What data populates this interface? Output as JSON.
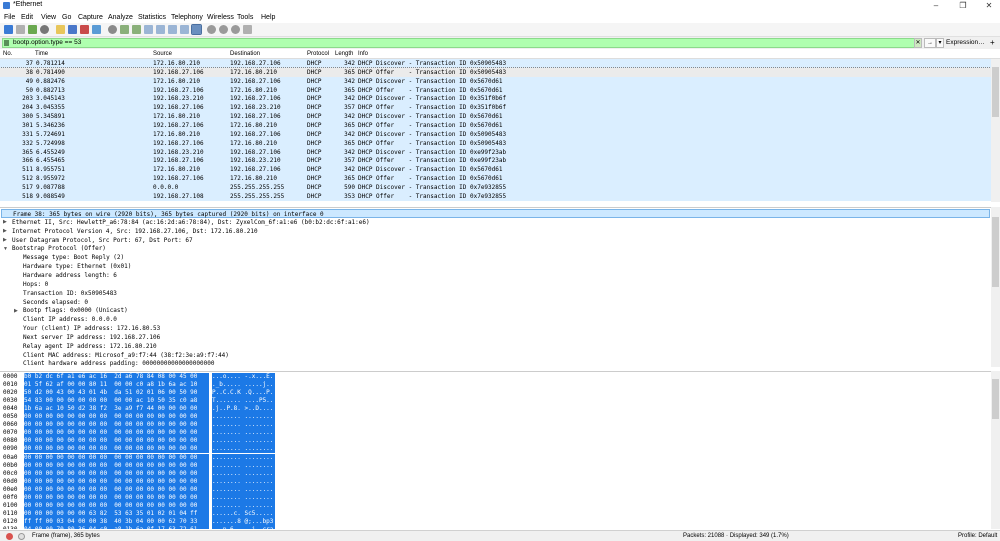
{
  "window": {
    "title": "*Ethernet"
  },
  "menu": [
    "File",
    "Edit",
    "View",
    "Go",
    "Capture",
    "Analyze",
    "Statistics",
    "Telephony",
    "Wireless",
    "Tools",
    "Help"
  ],
  "filter": {
    "value": "bootp.option.type == 53",
    "expression_label": "Expression…",
    "plus": "+"
  },
  "packet_list": {
    "columns": [
      "No.",
      "Time",
      "Source",
      "Destination",
      "Protocol",
      "Length",
      "Info"
    ],
    "rows": [
      [
        "37",
        "0.781214",
        "172.16.80.210",
        "192.168.27.106",
        "DHCP",
        "342",
        "DHCP Discover - Transaction ID 0x50905483"
      ],
      [
        "38",
        "0.781490",
        "192.168.27.106",
        "172.16.80.210",
        "DHCP",
        "365",
        "DHCP Offer    - Transaction ID 0x50905483"
      ],
      [
        "49",
        "0.882476",
        "172.16.80.210",
        "192.168.27.106",
        "DHCP",
        "342",
        "DHCP Discover - Transaction ID 0x5670d61"
      ],
      [
        "50",
        "0.882713",
        "192.168.27.106",
        "172.16.80.210",
        "DHCP",
        "365",
        "DHCP Offer    - Transaction ID 0x5670d61"
      ],
      [
        "203",
        "3.045143",
        "192.168.23.210",
        "192.168.27.106",
        "DHCP",
        "342",
        "DHCP Discover - Transaction ID 0x351f0b6f"
      ],
      [
        "204",
        "3.045355",
        "192.168.27.106",
        "192.168.23.210",
        "DHCP",
        "357",
        "DHCP Offer    - Transaction ID 0x351f0b6f"
      ],
      [
        "300",
        "5.345891",
        "172.16.80.210",
        "192.168.27.106",
        "DHCP",
        "342",
        "DHCP Discover - Transaction ID 0x5670d61"
      ],
      [
        "301",
        "5.346236",
        "192.168.27.106",
        "172.16.80.210",
        "DHCP",
        "365",
        "DHCP Offer    - Transaction ID 0x5670d61"
      ],
      [
        "331",
        "5.724691",
        "172.16.80.210",
        "192.168.27.106",
        "DHCP",
        "342",
        "DHCP Discover - Transaction ID 0x50905483"
      ],
      [
        "332",
        "5.724998",
        "192.168.27.106",
        "172.16.80.210",
        "DHCP",
        "365",
        "DHCP Offer    - Transaction ID 0x50905483"
      ],
      [
        "365",
        "6.455249",
        "192.168.23.210",
        "192.168.27.106",
        "DHCP",
        "342",
        "DHCP Discover - Transaction ID 0xe99f23ab"
      ],
      [
        "366",
        "6.455465",
        "192.168.27.106",
        "192.168.23.210",
        "DHCP",
        "357",
        "DHCP Offer    - Transaction ID 0xe99f23ab"
      ],
      [
        "511",
        "8.955751",
        "172.16.80.210",
        "192.168.27.106",
        "DHCP",
        "342",
        "DHCP Discover - Transaction ID 0x5670d61"
      ],
      [
        "512",
        "8.955972",
        "192.168.27.106",
        "172.16.80.210",
        "DHCP",
        "365",
        "DHCP Offer    - Transaction ID 0x5670d61"
      ],
      [
        "517",
        "9.087788",
        "0.0.0.0",
        "255.255.255.255",
        "DHCP",
        "590",
        "DHCP Discover - Transaction ID 0x7e932855"
      ],
      [
        "518",
        "9.088549",
        "192.168.27.108",
        "255.255.255.255",
        "DHCP",
        "353",
        "DHCP Offer    - Transaction ID 0x7e932855"
      ]
    ],
    "selected_index": 1
  },
  "details": [
    {
      "text": "Frame 38: 365 bytes on wire (2920 bits), 365 bytes captured (2920 bits) on interface 0",
      "level": 0,
      "expander": "closed",
      "selected": true
    },
    {
      "text": "Ethernet II, Src: HewlettP_a6:78:84 (ac:16:2d:a6:78:84), Dst: ZyxelCom_6f:a1:e6 (b0:b2:dc:6f:a1:e6)",
      "level": 0,
      "expander": "closed"
    },
    {
      "text": "Internet Protocol Version 4, Src: 192.168.27.106, Dst: 172.16.80.210",
      "level": 0,
      "expander": "closed"
    },
    {
      "text": "User Datagram Protocol, Src Port: 67, Dst Port: 67",
      "level": 0,
      "expander": "closed"
    },
    {
      "text": "Bootstrap Protocol (Offer)",
      "level": 0,
      "expander": "open"
    },
    {
      "text": "Message type: Boot Reply (2)",
      "level": 1
    },
    {
      "text": "Hardware type: Ethernet (0x01)",
      "level": 1
    },
    {
      "text": "Hardware address length: 6",
      "level": 1
    },
    {
      "text": "Hops: 0",
      "level": 1
    },
    {
      "text": "Transaction ID: 0x50905483",
      "level": 1
    },
    {
      "text": "Seconds elapsed: 0",
      "level": 1
    },
    {
      "text": "Bootp flags: 0x0000 (Unicast)",
      "level": 1,
      "expander": "closed"
    },
    {
      "text": "Client IP address: 0.0.0.0",
      "level": 1
    },
    {
      "text": "Your (client) IP address: 172.16.80.53",
      "level": 1
    },
    {
      "text": "Next server IP address: 192.168.27.106",
      "level": 1
    },
    {
      "text": "Relay agent IP address: 172.16.80.210",
      "level": 1
    },
    {
      "text": "Client MAC address: Microsof_a9:f7:44 (38:f2:3e:a9:f7:44)",
      "level": 1
    },
    {
      "text": "Client hardware address padding: 00000000000000000000",
      "level": 1
    }
  ],
  "bytes": [
    [
      "0000",
      "b0 b2 dc 6f a1 e6 ac 16  2d a6 78 84 08 00 45 00",
      "...o.... -.x...E."
    ],
    [
      "0010",
      "01 5f 62 af 00 00 80 11  00 00 c0 a8 1b 6a ac 10",
      "._b..... .....j.."
    ],
    [
      "0020",
      "50 d2 00 43 00 43 01 4b  da 51 02 01 06 00 50 90",
      "P..C.C.K .Q....P."
    ],
    [
      "0030",
      "54 83 00 00 00 00 00 00  00 00 ac 10 50 35 c0 a8",
      "T....... ....P5.."
    ],
    [
      "0040",
      "1b 6a ac 10 50 d2 38 f2  3e a9 f7 44 00 00 00 00",
      ".j..P.8. >..D...."
    ],
    [
      "0050",
      "00 00 00 00 00 00 00 00  00 00 00 00 00 00 00 00",
      "........ ........"
    ],
    [
      "0060",
      "00 00 00 00 00 00 00 00  00 00 00 00 00 00 00 00",
      "........ ........"
    ],
    [
      "0070",
      "00 00 00 00 00 00 00 00  00 00 00 00 00 00 00 00",
      "........ ........"
    ],
    [
      "0080",
      "00 00 00 00 00 00 00 00  00 00 00 00 00 00 00 00",
      "........ ........"
    ],
    [
      "0090",
      "00 00 00 00 00 00 00 00  00 00 00 00 00 00 00 00",
      "........ ........"
    ],
    [
      "00a0",
      "00 00 00 00 00 00 00 00  00 00 00 00 00 00 00 00",
      "........ ........"
    ],
    [
      "00b0",
      "00 00 00 00 00 00 00 00  00 00 00 00 00 00 00 00",
      "........ ........"
    ],
    [
      "00c0",
      "00 00 00 00 00 00 00 00  00 00 00 00 00 00 00 00",
      "........ ........"
    ],
    [
      "00d0",
      "00 00 00 00 00 00 00 00  00 00 00 00 00 00 00 00",
      "........ ........"
    ],
    [
      "00e0",
      "00 00 00 00 00 00 00 00  00 00 00 00 00 00 00 00",
      "........ ........"
    ],
    [
      "00f0",
      "00 00 00 00 00 00 00 00  00 00 00 00 00 00 00 00",
      "........ ........"
    ],
    [
      "0100",
      "00 00 00 00 00 00 00 00  00 00 00 00 00 00 00 00",
      "........ ........"
    ],
    [
      "0110",
      "00 00 00 00 00 00 63 82  53 63 35 01 02 01 04 ff",
      "......c. Sc5....."
    ],
    [
      "0120",
      "ff ff 00 03 04 00 00 38  40 3b 04 00 00 62 70 33",
      ".......8 @;...bp3"
    ],
    [
      "0130",
      "04 00 00 70 80 36 04 c0  a8 1b 6a 0f 17 63 72 61",
      "...p.6.. ..j..cra"
    ]
  ],
  "status": {
    "frame": "Frame (frame), 365 bytes",
    "packets": "Packets: 21088 · Displayed: 349 (1.7%)",
    "profile": "Profile: Default"
  },
  "colors": {
    "row_bg": "#daeeff",
    "filter_ok": "#afffaf",
    "bytes_highlight": "#1c79e6"
  }
}
